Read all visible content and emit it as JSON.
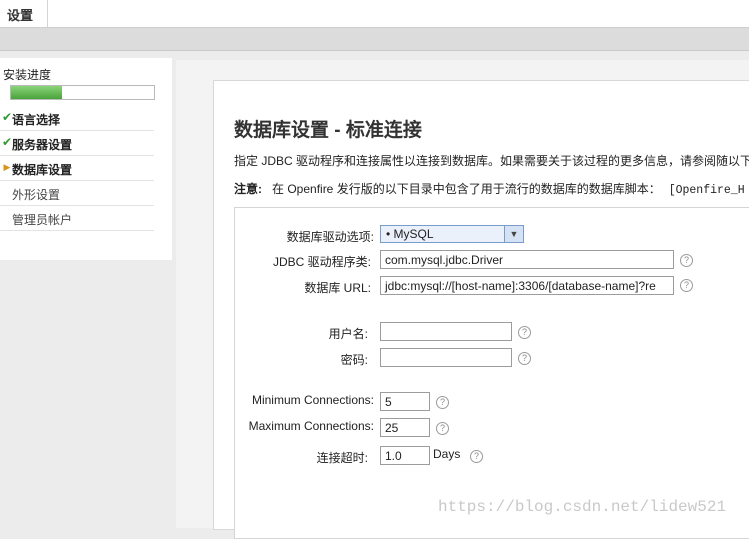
{
  "top_tab": "设置",
  "sidebar": {
    "progress_label": "安装进度",
    "progress_fraction": 0.36,
    "items": [
      {
        "label": "语言选择",
        "state": "done"
      },
      {
        "label": "服务器设置",
        "state": "done"
      },
      {
        "label": "数据库设置",
        "state": "active"
      },
      {
        "label": "外形设置",
        "state": "pending"
      },
      {
        "label": "管理员帐户",
        "state": "pending"
      }
    ]
  },
  "main": {
    "title": "数据库设置 - 标准连接",
    "description": "指定 JDBC 驱动程序和连接属性以连接到数据库。如果需要关于该过程的更多信息，请参阅随以下",
    "note_label": "注意:",
    "note_text": "在 Openfire 发行版的以下目录中包含了用于流行的数据库的数据库脚本：",
    "note_path": "[Openfire_H"
  },
  "form": {
    "driver_label": "数据库驱动选项:",
    "driver_value": "• MySQL",
    "jdbc_label": "JDBC 驱动程序类:",
    "jdbc_value": "com.mysql.jdbc.Driver",
    "url_label": "数据库 URL:",
    "url_value": "jdbc:mysql://[host-name]:3306/[database-name]?re",
    "username_label": "用户名:",
    "username_value": "",
    "password_label": "密码:",
    "password_value": "",
    "min_conn_label": "Minimum Connections:",
    "min_conn_value": "5",
    "max_conn_label": "Maximum Connections:",
    "max_conn_value": "25",
    "timeout_label": "连接超时:",
    "timeout_value": "1.0",
    "timeout_unit": "Days",
    "help_glyph": "?"
  },
  "watermark": "https://blog.csdn.net/lidew521",
  "colors": {
    "done_check": "#2f9a2f",
    "active_arrow": "#d9951a",
    "progress_fill": "#4aa33a"
  }
}
